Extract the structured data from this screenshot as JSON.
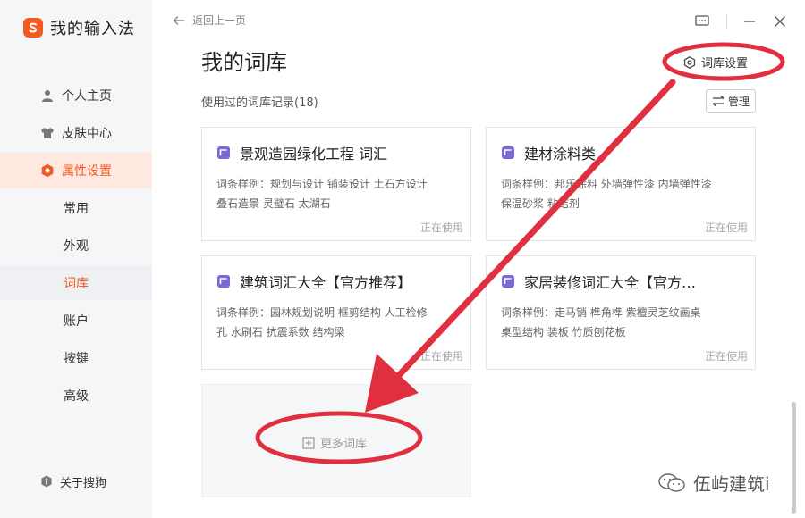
{
  "app": {
    "title": "我的输入法"
  },
  "sidebar": {
    "items": [
      {
        "label": "个人主页",
        "icon": "person-icon"
      },
      {
        "label": "皮肤中心",
        "icon": "shirt-icon"
      },
      {
        "label": "属性设置",
        "icon": "gear-icon",
        "active": true
      }
    ],
    "sub_items": [
      {
        "label": "常用"
      },
      {
        "label": "外观"
      },
      {
        "label": "词库",
        "active": true
      },
      {
        "label": "账户"
      },
      {
        "label": "按键"
      },
      {
        "label": "高级"
      }
    ],
    "about": "关于搜狗"
  },
  "topbar": {
    "back_label": "返回上一页"
  },
  "main": {
    "title": "我的词库",
    "settings_label": "词库设置",
    "section_label": "使用过的词库记录(18)",
    "manage_label": "管理",
    "cards": [
      {
        "title": "景观造园绿化工程 词汇",
        "sample": "词条样例：规划与设计  铺装设计  土石方设计  叠石造景  灵璧石  太湖石",
        "status": "正在使用"
      },
      {
        "title": "建材涂料类",
        "sample": "词条样例：邦乐涂料  外墙弹性漆  内墙弹性漆  保温砂浆  粘结剂",
        "status": "正在使用"
      },
      {
        "title": "建筑词汇大全【官方推荐】",
        "sample": "词条样例：园林规划说明  框剪结构  人工检修孔  水刷石  抗震系数  结构梁",
        "status": "正在使用"
      },
      {
        "title": "家居装修词汇大全【官方…",
        "sample": "词条样例：走马销  榫角榫  紫檀灵芝纹画桌  桌型结构  装板  竹质刨花板",
        "status": "正在使用"
      }
    ],
    "more_label": "更多词库"
  },
  "watermark": {
    "text": "伍屿建筑i"
  },
  "colors": {
    "accent": "#f05a24",
    "annotation": "#e03040",
    "card_icon": "#7b68d8"
  }
}
